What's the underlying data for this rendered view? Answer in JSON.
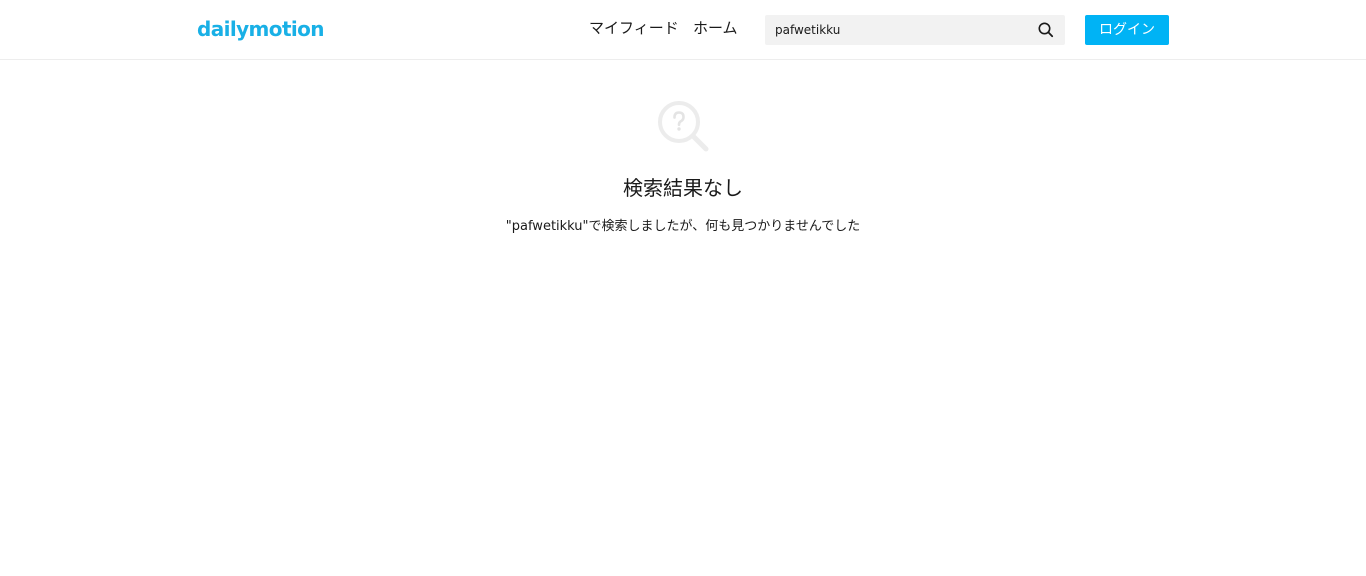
{
  "header": {
    "logo_text": "dailymotion",
    "brand_color": "#19b0e6",
    "nav": {
      "my_feed": "マイフィード",
      "home": "ホーム"
    },
    "search": {
      "value": "pafwetikku",
      "icon": "search-icon"
    },
    "login": {
      "label": "ログイン",
      "color": "#00b3f5"
    }
  },
  "main": {
    "empty_state": {
      "icon": "search-question-icon",
      "title": "検索結果なし",
      "message": "\"pafwetikku\"で検索しましたが、何も見つかりませんでした"
    }
  }
}
